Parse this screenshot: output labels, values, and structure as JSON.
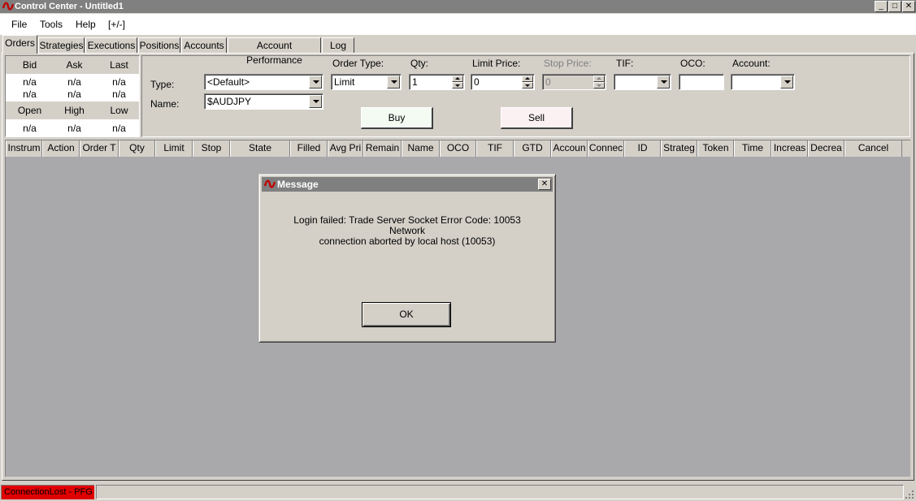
{
  "window": {
    "title": "Control Center - Untitled1",
    "controls": {
      "minimize": "_",
      "maximize": "□",
      "close": "✕"
    },
    "logo_icon": "ninja-logo-icon",
    "accent": "#c00000"
  },
  "menu": [
    "File",
    "Tools",
    "Help",
    "[+/-]"
  ],
  "tabs": [
    "Orders",
    "Strategies",
    "Executions",
    "Positions",
    "Accounts",
    "Account Performance",
    "Log"
  ],
  "active_tab": "Orders",
  "quotes": {
    "row1_headers": [
      "Bid",
      "Ask",
      "Last"
    ],
    "row1_values": [
      [
        "n/a",
        "n/a",
        "n/a"
      ],
      [
        "n/a",
        "n/a",
        "n/a"
      ]
    ],
    "row2_headers": [
      "Open",
      "High",
      "Low"
    ],
    "row2_values": [
      "n/a",
      "n/a",
      "n/a"
    ]
  },
  "order_entry": {
    "type_label": "Type:",
    "type_value": "<Default>",
    "name_label": "Name:",
    "name_value": "$AUDJPY",
    "order_type_label": "Order Type:",
    "order_type_value": "Limit",
    "qty_label": "Qty:",
    "qty_value": "1",
    "limit_price_label": "Limit Price:",
    "limit_price_value": "0",
    "stop_price_label": "Stop Price:",
    "stop_price_value": "0",
    "tif_label": "TIF:",
    "tif_value": "",
    "oco_label": "OCO:",
    "oco_value": "",
    "account_label": "Account:",
    "account_value": "",
    "buy_label": "Buy",
    "sell_label": "Sell",
    "buy_color": "#f3fbf3",
    "sell_color": "#fbf0f2"
  },
  "grid_columns": [
    "Instrum",
    "Action",
    "Order T",
    "Qty",
    "Limit",
    "Stop",
    "State",
    "Filled",
    "Avg Pri",
    "Remain",
    "Name",
    "OCO",
    "TIF",
    "GTD",
    "Accoun",
    "Connec",
    "ID",
    "Strateg",
    "Token",
    "Time",
    "Increas",
    "Decrea",
    "Cancel"
  ],
  "dialog": {
    "title": "Message",
    "message_line1": "Login failed: Trade Server Socket Error Code: 10053 Network",
    "message_line2": "connection aborted by local host (10053)",
    "ok_label": "OK"
  },
  "status": {
    "connection": "ConnectionLost - PFG",
    "connection_color": "#e00000"
  }
}
